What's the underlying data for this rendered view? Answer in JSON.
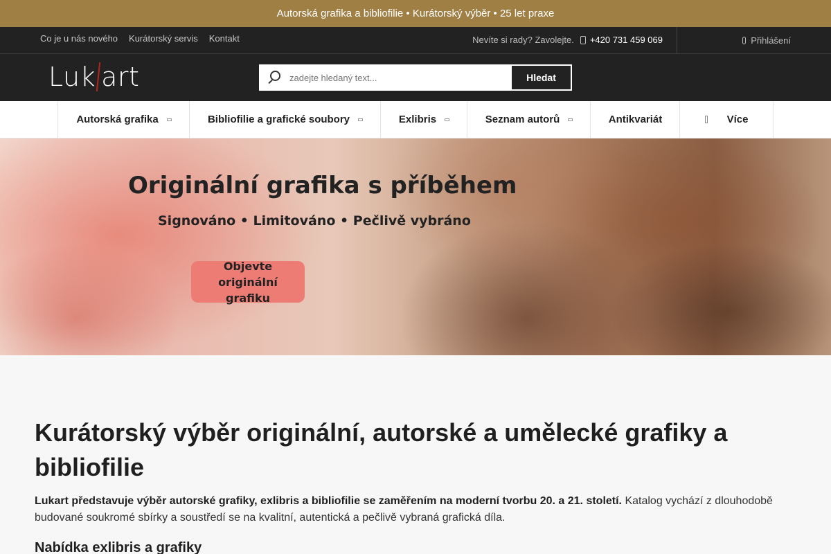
{
  "announcement": "Autorská grafika a bibliofilie • Kurátorský výběr • 25 let praxe",
  "topbar": {
    "links": [
      "Co je u nás nového",
      "Kurátorský servis",
      "Kontakt"
    ],
    "contact_prompt": "Nevíte si rady? Zavolejte.",
    "phone": "+420 731 459 069",
    "login": "Přihlášení",
    "icons": {
      "phone": "phone-icon",
      "login": "user-icon"
    }
  },
  "header": {
    "logo_left": "Luk",
    "logo_right": "art",
    "search_placeholder": "zadejte hledaný text...",
    "search_button": "Hledat"
  },
  "nav": {
    "items": [
      {
        "label": "Autorská grafika",
        "has_submenu": true
      },
      {
        "label": "Bibliofilie a grafické soubory",
        "has_submenu": true
      },
      {
        "label": "Exlibris",
        "has_submenu": true
      },
      {
        "label": "Seznam autorů",
        "has_submenu": true
      },
      {
        "label": "Antikvariát",
        "has_submenu": false
      },
      {
        "label": "Více",
        "has_submenu": false
      }
    ]
  },
  "hero": {
    "title": "Originální grafika s příběhem",
    "subtitle": "Signováno • Limitováno • Pečlivě vybráno",
    "cta": "Objevte originální grafiku"
  },
  "main": {
    "heading": "Kurátorský výběr originální, autorské a umělecké grafiky a bibliofilie",
    "intro_bold": "Lukart představuje výběr autorské grafiky, exlibris a bibliofilie se zaměřením na moderní tvorbu 20. a 21. století.",
    "intro_rest": " Katalog vychází z dlouhodobě budované soukromé sbírky a soustředí se na kvalitní, autentická a pečlivě vybraná grafická díla.",
    "subheading": "Nabídka exlibris a grafiky"
  },
  "colors": {
    "announcement_bg": "#a07f45",
    "header_bg": "#222222",
    "cta_bg": "#ed7c74",
    "logo_accent": "#b3261e"
  }
}
